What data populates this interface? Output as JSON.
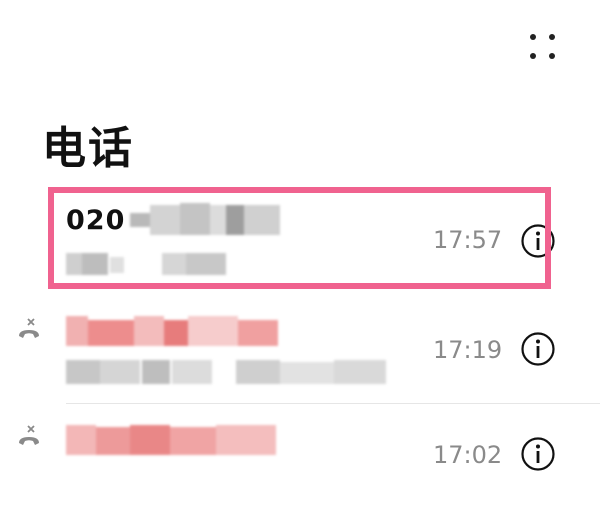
{
  "header": {
    "title": "电话",
    "more_icon": "more-dots-icon"
  },
  "calls": [
    {
      "number": "020",
      "time": "17:57",
      "highlighted": true,
      "type": "incoming"
    },
    {
      "number": "",
      "time": "17:19",
      "highlighted": false,
      "type": "missed"
    },
    {
      "number": "",
      "time": "17:02",
      "highlighted": false,
      "type": "missed"
    }
  ],
  "colors": {
    "highlight": "#f0628f",
    "time": "#8a8a8a",
    "missed_number": "#e55a5a"
  }
}
